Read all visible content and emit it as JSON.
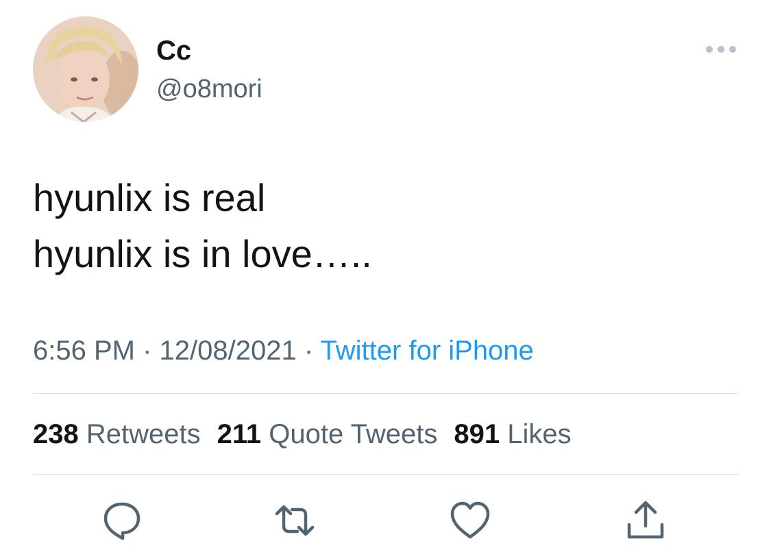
{
  "author": {
    "display_name": "Cc",
    "handle": "@o8mori",
    "avatar": "avatar-photo"
  },
  "tweet": {
    "lines": [
      "hyunlix is real",
      "hyunlix is in love….."
    ]
  },
  "meta": {
    "time": "6:56 PM",
    "separator": " · ",
    "date": "12/08/2021",
    "source": "Twitter for iPhone"
  },
  "stats": {
    "retweets_count": "238",
    "retweets_label": "Retweets",
    "quotes_count": "211",
    "quotes_label": "Quote Tweets",
    "likes_count": "891",
    "likes_label": "Likes"
  },
  "icons": {
    "more": "more-icon",
    "reply": "reply-icon",
    "retweet": "retweet-icon",
    "like": "like-icon",
    "share": "share-icon"
  },
  "colors": {
    "text": "#0f1419",
    "secondary": "#536471",
    "link": "#1d9bf0",
    "divider": "#dde2e6"
  }
}
